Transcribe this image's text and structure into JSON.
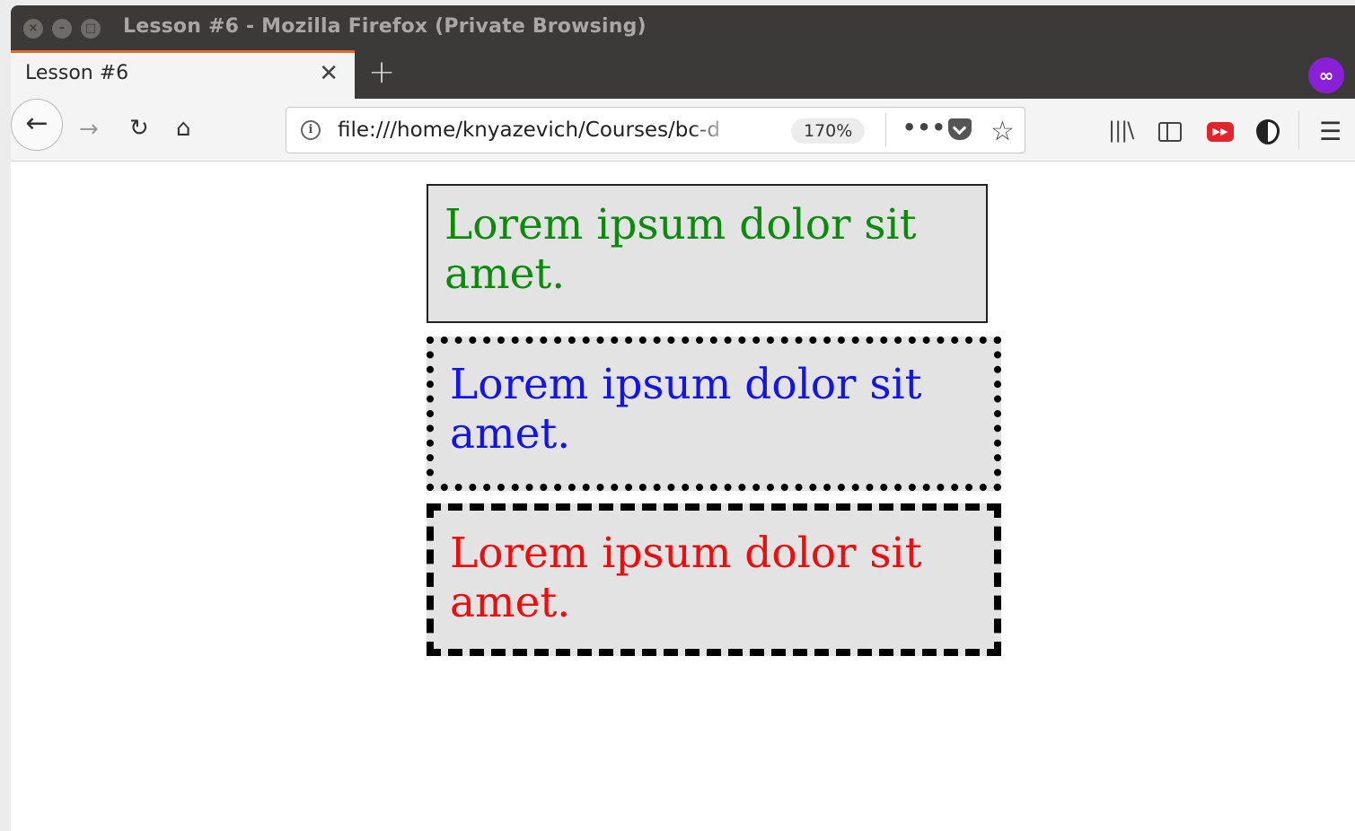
{
  "window": {
    "title": "Lesson #6 - Mozilla Firefox (Private Browsing)",
    "controls": {
      "close": "×",
      "minimize": "–",
      "maximize": "□"
    }
  },
  "tabs": [
    {
      "title": "Lesson #6",
      "close": "✕",
      "active": true
    }
  ],
  "new_tab_label": "+",
  "private_badge": "∞",
  "toolbar": {
    "back": "←",
    "forward": "→",
    "reload": "↻",
    "home": "⌂",
    "info": "i",
    "url": "file:///home/knyazevich/Courses/bc-d",
    "zoom": "170%",
    "more": "•••",
    "star": "☆",
    "library": "|||\\",
    "ext_red": "▶▶",
    "menu": "☰"
  },
  "page": {
    "boxes": [
      {
        "text": "Lorem ipsum dolor sit amet.",
        "color": "#0b8a0b",
        "border": "solid"
      },
      {
        "text": "Lorem ipsum dolor sit amet.",
        "color": "#1414e6",
        "border": "dotted"
      },
      {
        "text": "Lorem ipsum dolor sit amet.",
        "color": "#ee0c0c",
        "border": "dashed"
      }
    ]
  },
  "colors": {
    "titlebar": "#3b3a38",
    "tab_accent": "#e66a2c",
    "private": "#8a21d8",
    "box_bg": "#e3e3e3"
  }
}
